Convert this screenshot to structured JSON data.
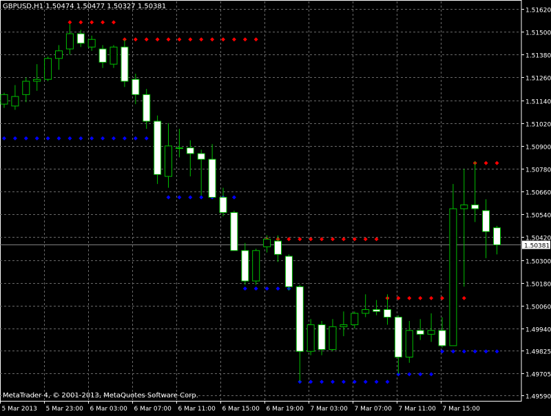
{
  "window": {
    "title": "GBPUSD,H1  1.50474 1.50477 1.50327 1.50381",
    "copyright": "MetaTrader 4, © 2001-2013, MetaQuotes Software Corp."
  },
  "colors": {
    "background": "#000000",
    "grid": "#6b6b6b",
    "candle_outline": "#00c000",
    "bull_fill": "#000000",
    "bear_fill": "#ffffff",
    "upper_dots": "#ff0000",
    "lower_dots": "#0000ff",
    "price_line": "#808080",
    "axis_text": "#ffffff"
  },
  "chart_data": {
    "type": "candlestick",
    "symbol": "GBPUSD",
    "timeframe": "H1",
    "ylim": [
      1.4956,
      1.5166
    ],
    "y_ticks": [
      "1.51620",
      "1.51500",
      "1.51380",
      "1.51260",
      "1.51140",
      "1.51020",
      "1.50900",
      "1.50780",
      "1.50660",
      "1.50540",
      "1.50420",
      "1.50300",
      "1.50180",
      "1.50060",
      "1.49940",
      "1.49825",
      "1.49705",
      "1.49590"
    ],
    "x_labels": [
      "5 Mar 2013",
      "5 Mar 23:00",
      "6 Mar 03:00",
      "6 Mar 07:00",
      "6 Mar 11:00",
      "6 Mar 15:00",
      "6 Mar 19:00",
      "7 Mar 03:00",
      "7 Mar 07:00",
      "7 Mar 11:00",
      "7 Mar 15:00"
    ],
    "current_price": "1.50381",
    "candles": [
      {
        "o": 1.5112,
        "h": 1.5118,
        "l": 1.511,
        "c": 1.5117
      },
      {
        "o": 1.5111,
        "h": 1.5122,
        "l": 1.5109,
        "c": 1.5116
      },
      {
        "o": 1.5117,
        "h": 1.5126,
        "l": 1.5113,
        "c": 1.5124
      },
      {
        "o": 1.5124,
        "h": 1.5133,
        "l": 1.5119,
        "c": 1.5125
      },
      {
        "o": 1.5125,
        "h": 1.5137,
        "l": 1.5124,
        "c": 1.5136
      },
      {
        "o": 1.5136,
        "h": 1.5143,
        "l": 1.513,
        "c": 1.514
      },
      {
        "o": 1.5141,
        "h": 1.5154,
        "l": 1.5138,
        "c": 1.5149
      },
      {
        "o": 1.5149,
        "h": 1.5151,
        "l": 1.5142,
        "c": 1.5144
      },
      {
        "o": 1.5142,
        "h": 1.5148,
        "l": 1.514,
        "c": 1.5146
      },
      {
        "o": 1.5141,
        "h": 1.5143,
        "l": 1.5131,
        "c": 1.5134
      },
      {
        "o": 1.5133,
        "h": 1.5143,
        "l": 1.5131,
        "c": 1.5142
      },
      {
        "o": 1.5142,
        "h": 1.5146,
        "l": 1.5121,
        "c": 1.5124
      },
      {
        "o": 1.5125,
        "h": 1.5128,
        "l": 1.5112,
        "c": 1.5117
      },
      {
        "o": 1.5117,
        "h": 1.512,
        "l": 1.5099,
        "c": 1.5103
      },
      {
        "o": 1.5103,
        "h": 1.5106,
        "l": 1.507,
        "c": 1.5075
      },
      {
        "o": 1.5074,
        "h": 1.5102,
        "l": 1.5068,
        "c": 1.509
      },
      {
        "o": 1.5089,
        "h": 1.5099,
        "l": 1.5084,
        "c": 1.5089
      },
      {
        "o": 1.5089,
        "h": 1.5093,
        "l": 1.5074,
        "c": 1.5086
      },
      {
        "o": 1.5086,
        "h": 1.5088,
        "l": 1.5064,
        "c": 1.5083
      },
      {
        "o": 1.5083,
        "h": 1.5091,
        "l": 1.5063,
        "c": 1.5063
      },
      {
        "o": 1.5063,
        "h": 1.5068,
        "l": 1.5053,
        "c": 1.5055
      },
      {
        "o": 1.5055,
        "h": 1.5056,
        "l": 1.5036,
        "c": 1.5035
      },
      {
        "o": 1.5035,
        "h": 1.5039,
        "l": 1.5017,
        "c": 1.5019
      },
      {
        "o": 1.5019,
        "h": 1.5036,
        "l": 1.5017,
        "c": 1.5035
      },
      {
        "o": 1.5037,
        "h": 1.5043,
        "l": 1.5034,
        "c": 1.5041
      },
      {
        "o": 1.504,
        "h": 1.5043,
        "l": 1.5029,
        "c": 1.5033
      },
      {
        "o": 1.5032,
        "h": 1.5033,
        "l": 1.5014,
        "c": 1.5016
      },
      {
        "o": 1.5016,
        "h": 1.5017,
        "l": 1.4966,
        "c": 1.4982
      },
      {
        "o": 1.4982,
        "h": 1.4999,
        "l": 1.498,
        "c": 1.4996
      },
      {
        "o": 1.4996,
        "h": 1.4998,
        "l": 1.498,
        "c": 1.4983
      },
      {
        "o": 1.4983,
        "h": 1.4999,
        "l": 1.4982,
        "c": 1.4995
      },
      {
        "o": 1.4995,
        "h": 1.5003,
        "l": 1.499,
        "c": 1.4996
      },
      {
        "o": 1.4996,
        "h": 1.5003,
        "l": 1.4994,
        "c": 1.5002
      },
      {
        "o": 1.5002,
        "h": 1.5012,
        "l": 1.5,
        "c": 1.5004
      },
      {
        "o": 1.5004,
        "h": 1.5009,
        "l": 1.5001,
        "c": 1.5003
      },
      {
        "o": 1.5004,
        "h": 1.5012,
        "l": 1.4996,
        "c": 1.5
      },
      {
        "o": 1.5,
        "h": 1.5001,
        "l": 1.497,
        "c": 1.4979
      },
      {
        "o": 1.4979,
        "h": 1.4998,
        "l": 1.4976,
        "c": 1.4993
      },
      {
        "o": 1.4993,
        "h": 1.4999,
        "l": 1.4988,
        "c": 1.4991
      },
      {
        "o": 1.4991,
        "h": 1.5002,
        "l": 1.4987,
        "c": 1.4993
      },
      {
        "o": 1.4993,
        "h": 1.5,
        "l": 1.4984,
        "c": 1.4985
      },
      {
        "o": 1.4985,
        "h": 1.507,
        "l": 1.4985,
        "c": 1.5057
      },
      {
        "o": 1.5057,
        "h": 1.5078,
        "l": 1.5016,
        "c": 1.5059
      },
      {
        "o": 1.5059,
        "h": 1.5082,
        "l": 1.505,
        "c": 1.5057
      },
      {
        "o": 1.5056,
        "h": 1.5062,
        "l": 1.5031,
        "c": 1.5045
      },
      {
        "o": 1.5047,
        "h": 1.5048,
        "l": 1.5033,
        "c": 1.5038
      }
    ],
    "upper_dots": [
      {
        "from": 6,
        "to": 10,
        "value": 1.5155
      },
      {
        "from": 11,
        "to": 23,
        "value": 1.5146
      },
      {
        "from": 24,
        "to": 34,
        "value": 1.5041
      },
      {
        "from": 35,
        "to": 42,
        "value": 1.501
      },
      {
        "from": 43,
        "to": 45,
        "value": 1.5081
      }
    ],
    "lower_dots": [
      {
        "from": 0,
        "to": 14,
        "value": 1.5094
      },
      {
        "from": 15,
        "to": 21,
        "value": 1.5063
      },
      {
        "from": 22,
        "to": 26,
        "value": 1.5015
      },
      {
        "from": 27,
        "to": 35,
        "value": 1.4966
      },
      {
        "from": 36,
        "to": 39,
        "value": 1.497
      },
      {
        "from": 40,
        "to": 45,
        "value": 1.4982
      }
    ]
  }
}
